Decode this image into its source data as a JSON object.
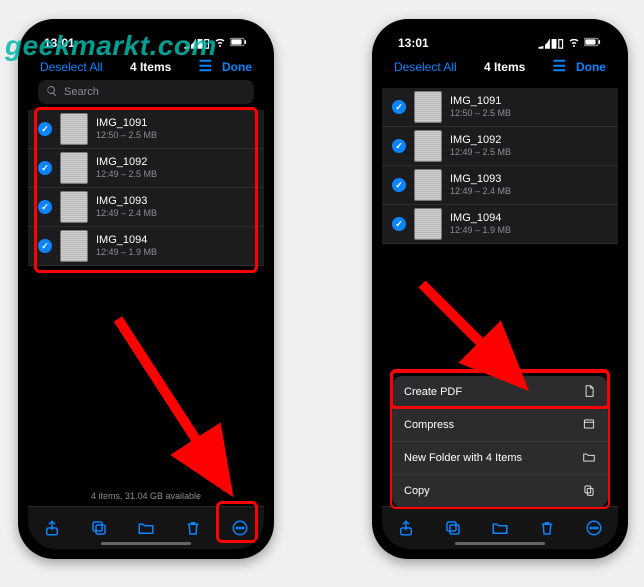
{
  "watermark": "geekmarkt.com",
  "status": {
    "time": "13:01"
  },
  "nav": {
    "deselect": "Deselect All",
    "title": "4 Items",
    "done": "Done"
  },
  "search": {
    "placeholder": "Search"
  },
  "files": [
    {
      "name": "IMG_1091",
      "meta": "12:50 – 2.5 MB"
    },
    {
      "name": "IMG_1092",
      "meta": "12:49 – 2.5 MB"
    },
    {
      "name": "IMG_1093",
      "meta": "12:49 – 2.4 MB"
    },
    {
      "name": "IMG_1094",
      "meta": "12:49 – 1.9 MB"
    }
  ],
  "bottom_info": "4 items, 31.04 GB available",
  "menu": {
    "create_pdf": "Create PDF",
    "compress": "Compress",
    "new_folder": "New Folder with 4 Items",
    "copy": "Copy"
  }
}
